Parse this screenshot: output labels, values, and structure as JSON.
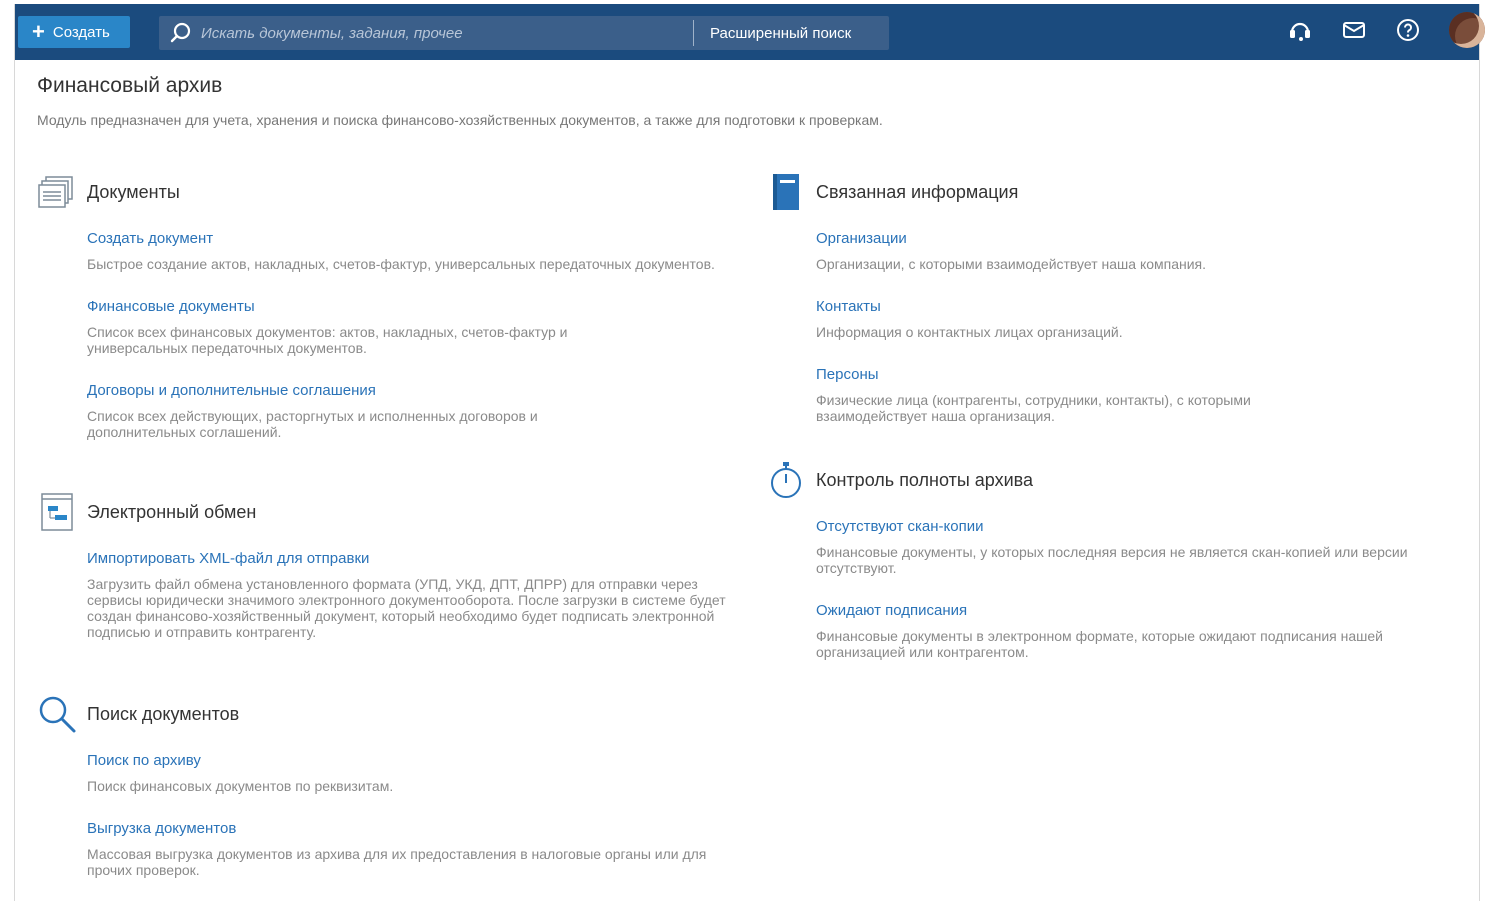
{
  "toolbar": {
    "create_label": "Создать",
    "search_placeholder": "Искать документы, задания, прочее",
    "advanced_search": "Расширенный поиск",
    "icons": [
      "headset-icon",
      "mail-icon",
      "help-icon"
    ]
  },
  "page": {
    "title": "Финансовый архив",
    "subtitle": "Модуль предназначен для учета, хранения и поиска финансово-хозяйственных документов, а также для подготовки к проверкам."
  },
  "sections": {
    "documents": {
      "title": "Документы",
      "items": [
        {
          "link": "Создать документ",
          "desc": "Быстрое создание актов, накладных, счетов-фактур, универсальных передаточных документов."
        },
        {
          "link": "Финансовые документы",
          "desc": "Список всех финансовых документов: актов, накладных, счетов-фактур и универсальных передаточных документов."
        },
        {
          "link": "Договоры и дополнительные соглашения",
          "desc": "Список всех действующих, расторгнутых и исполненных договоров и дополнительных соглашений."
        }
      ]
    },
    "exchange": {
      "title": "Электронный обмен",
      "items": [
        {
          "link": "Импортировать XML-файл для отправки",
          "desc": "Загрузить файл обмена установленного формата (УПД, УКД, ДПТ, ДПРР) для отправки через сервисы юридически значимого электронного документооборота. После загрузки в системе будет создан финансово-хозяйственный документ, который необходимо будет подписать электронной подписью и отправить контрагенту."
        }
      ]
    },
    "search": {
      "title": "Поиск документов",
      "items": [
        {
          "link": "Поиск по архиву",
          "desc": "Поиск финансовых документов по реквизитам."
        },
        {
          "link": "Выгрузка документов",
          "desc": "Массовая выгрузка документов из архива для их предоставления в налоговые органы или для прочих проверок."
        }
      ]
    },
    "related": {
      "title": "Связанная информация",
      "items": [
        {
          "link": "Организации",
          "desc": "Организации, с которыми взаимодействует наша компания."
        },
        {
          "link": "Контакты",
          "desc": "Информация о контактных лицах организаций."
        },
        {
          "link": "Персоны",
          "desc": "Физические лица (контрагенты, сотрудники, контакты), с которыми взаимодействует наша организация."
        }
      ]
    },
    "control": {
      "title": "Контроль полноты архива",
      "items": [
        {
          "link": "Отсутствуют скан-копии",
          "desc": "Финансовые документы, у которых последняя версия не является скан-копией или версии отсутствуют."
        },
        {
          "link": "Ожидают подписания",
          "desc": "Финансовые документы в электронном формате, которые ожидают подписания нашей организацией или контрагентом."
        }
      ]
    }
  }
}
